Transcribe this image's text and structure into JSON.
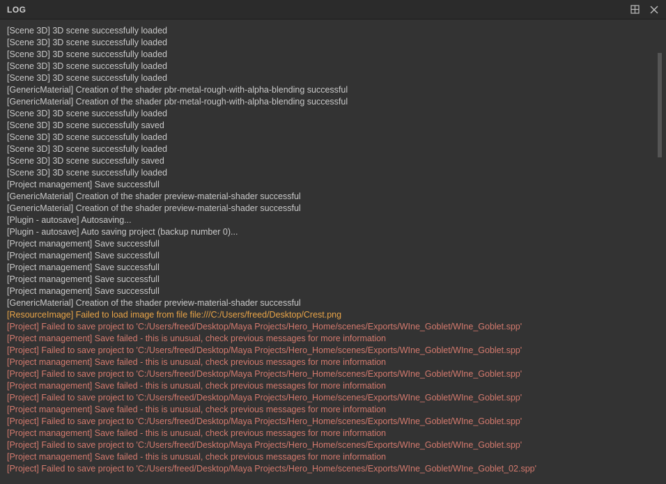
{
  "title": "LOG",
  "log": [
    {
      "level": "info",
      "text": "[Scene 3D] 3D scene successfully loaded"
    },
    {
      "level": "info",
      "text": "[Scene 3D] 3D scene successfully loaded"
    },
    {
      "level": "info",
      "text": "[Scene 3D] 3D scene successfully loaded"
    },
    {
      "level": "info",
      "text": "[Scene 3D] 3D scene successfully loaded"
    },
    {
      "level": "info",
      "text": "[Scene 3D] 3D scene successfully loaded"
    },
    {
      "level": "info",
      "text": "[GenericMaterial] Creation of the shader pbr-metal-rough-with-alpha-blending successful"
    },
    {
      "level": "info",
      "text": "[GenericMaterial] Creation of the shader pbr-metal-rough-with-alpha-blending successful"
    },
    {
      "level": "info",
      "text": "[Scene 3D] 3D scene successfully loaded"
    },
    {
      "level": "info",
      "text": "[Scene 3D] 3D scene successfully saved"
    },
    {
      "level": "info",
      "text": "[Scene 3D] 3D scene successfully loaded"
    },
    {
      "level": "info",
      "text": "[Scene 3D] 3D scene successfully loaded"
    },
    {
      "level": "info",
      "text": "[Scene 3D] 3D scene successfully saved"
    },
    {
      "level": "info",
      "text": "[Scene 3D] 3D scene successfully loaded"
    },
    {
      "level": "info",
      "text": "[Project management] Save successfull"
    },
    {
      "level": "info",
      "text": "[GenericMaterial] Creation of the shader preview-material-shader successful"
    },
    {
      "level": "info",
      "text": "[GenericMaterial] Creation of the shader preview-material-shader successful"
    },
    {
      "level": "info",
      "text": "[Plugin - autosave] Autosaving..."
    },
    {
      "level": "info",
      "text": "[Plugin - autosave] Auto saving project (backup number 0)..."
    },
    {
      "level": "info",
      "text": "[Project management] Save successfull"
    },
    {
      "level": "info",
      "text": "[Project management] Save successfull"
    },
    {
      "level": "info",
      "text": "[Project management] Save successfull"
    },
    {
      "level": "info",
      "text": "[Project management] Save successfull"
    },
    {
      "level": "info",
      "text": "[Project management] Save successfull"
    },
    {
      "level": "info",
      "text": "[GenericMaterial] Creation of the shader preview-material-shader successful"
    },
    {
      "level": "warn",
      "text": "[ResourceImage] Failed to load image from file file:///C:/Users/freed/Desktop/Crest.png"
    },
    {
      "level": "error",
      "text": "[Project] Failed to save project to 'C:/Users/freed/Desktop/Maya Projects/Hero_Home/scenes/Exports/WIne_Goblet/WIne_Goblet.spp'"
    },
    {
      "level": "error",
      "text": "[Project management] Save failed - this is unusual, check previous messages for more information"
    },
    {
      "level": "error",
      "text": "[Project] Failed to save project to 'C:/Users/freed/Desktop/Maya Projects/Hero_Home/scenes/Exports/WIne_Goblet/WIne_Goblet.spp'"
    },
    {
      "level": "error",
      "text": "[Project management] Save failed - this is unusual, check previous messages for more information"
    },
    {
      "level": "error",
      "text": "[Project] Failed to save project to 'C:/Users/freed/Desktop/Maya Projects/Hero_Home/scenes/Exports/WIne_Goblet/WIne_Goblet.spp'"
    },
    {
      "level": "error",
      "text": "[Project management] Save failed - this is unusual, check previous messages for more information"
    },
    {
      "level": "error",
      "text": "[Project] Failed to save project to 'C:/Users/freed/Desktop/Maya Projects/Hero_Home/scenes/Exports/WIne_Goblet/WIne_Goblet.spp'"
    },
    {
      "level": "error",
      "text": "[Project management] Save failed - this is unusual, check previous messages for more information"
    },
    {
      "level": "error",
      "text": "[Project] Failed to save project to 'C:/Users/freed/Desktop/Maya Projects/Hero_Home/scenes/Exports/WIne_Goblet/WIne_Goblet.spp'"
    },
    {
      "level": "error",
      "text": "[Project management] Save failed - this is unusual, check previous messages for more information"
    },
    {
      "level": "error",
      "text": "[Project] Failed to save project to 'C:/Users/freed/Desktop/Maya Projects/Hero_Home/scenes/Exports/WIne_Goblet/WIne_Goblet.spp'"
    },
    {
      "level": "error",
      "text": "[Project management] Save failed - this is unusual, check previous messages for more information"
    },
    {
      "level": "error",
      "text": "[Project] Failed to save project to 'C:/Users/freed/Desktop/Maya Projects/Hero_Home/scenes/Exports/WIne_Goblet/WIne_Goblet_02.spp'"
    }
  ]
}
